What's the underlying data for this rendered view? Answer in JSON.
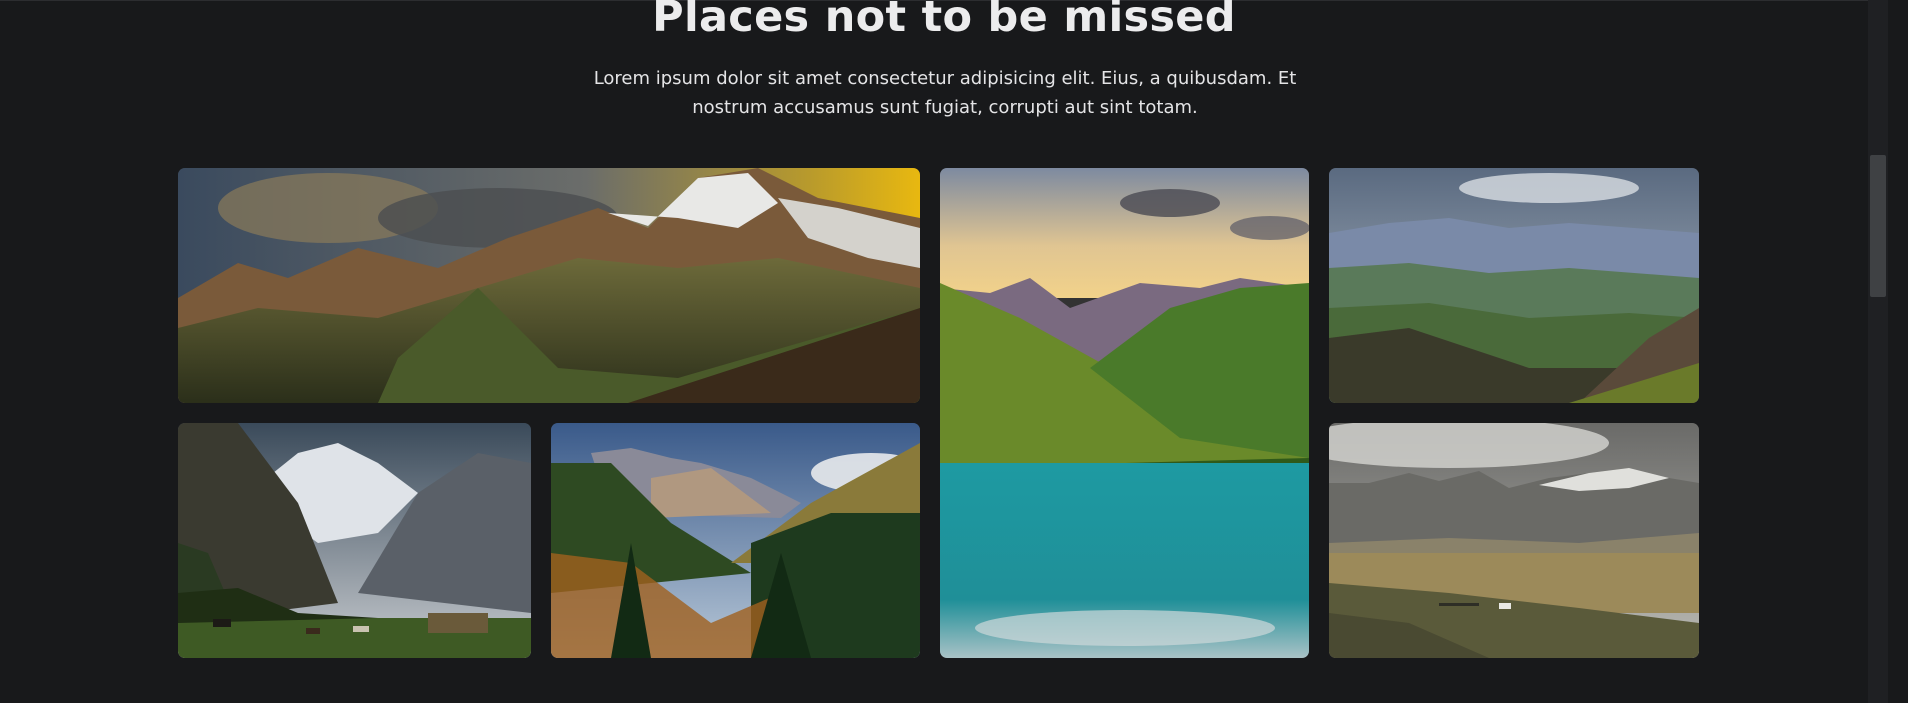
{
  "section": {
    "title": "Places not to be missed",
    "description": "Lorem ipsum dolor sit amet consectetur adipisicing elit. Eius, a quibusdam. Et nostrum accusamus sunt fugiat, corrupti aut sint totam."
  },
  "gallery": {
    "images": [
      {
        "alt": "mountain-range-sunset"
      },
      {
        "alt": "turquoise-lake-valley"
      },
      {
        "alt": "green-hills-valley"
      },
      {
        "alt": "snowy-peak-horses"
      },
      {
        "alt": "forest-mountain-valley"
      },
      {
        "alt": "snowy-ridge-plateau"
      }
    ]
  },
  "colors": {
    "background": "#18191b",
    "text": "#ececed"
  }
}
